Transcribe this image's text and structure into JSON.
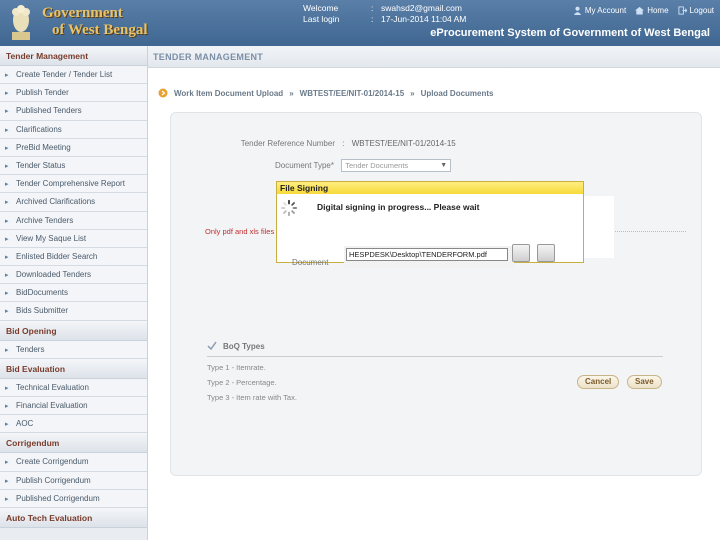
{
  "header": {
    "gov_line1": "Government",
    "gov_line2": "of West Bengal",
    "welcome_label": "Welcome",
    "welcome_value": "swahsd2@gmail.com",
    "lastlogin_label": "Last login",
    "lastlogin_value": "17-Jun-2014 11:04 AM",
    "sep": ":",
    "links": [
      "My Account",
      "Home",
      "Logout"
    ],
    "system_title": "eProcurement System of Government of West Bengal"
  },
  "sidebar": {
    "sections": [
      {
        "title": "Tender Management",
        "items": [
          "Create Tender / Tender List",
          "Publish Tender",
          "Published Tenders",
          "Clarifications",
          "PreBid Meeting",
          "Tender Status",
          "Tender Comprehensive Report",
          "Archived Clarifications",
          "Archive Tenders",
          "View My Saque List",
          "Enlisted Bidder Search",
          "Downloaded Tenders",
          "BidDocuments",
          "Bids Submitter"
        ]
      },
      {
        "title": "Bid Opening",
        "items": [
          "Tenders"
        ]
      },
      {
        "title": "Bid Evaluation",
        "items": [
          "Technical Evaluation",
          "Financial Evaluation",
          "AOC"
        ]
      },
      {
        "title": "Corrigendum",
        "items": [
          "Create Corrigendum",
          "Publish Corrigendum",
          "Published Corrigendum"
        ]
      },
      {
        "title": "Auto Tech Evaluation",
        "items": []
      }
    ]
  },
  "content": {
    "page_title": "TENDER MANAGEMENT",
    "breadcrumb": [
      "Work Item Document Upload",
      "WBTEST/EE/NIT-01/2014-15",
      "Upload Documents"
    ],
    "breadcrumb_sep": "»",
    "form": {
      "ref_label": "Tender Reference Number",
      "ref_value": "WBTEST/EE/NIT-01/2014-15",
      "doctype_label": "Document Type*",
      "doctype_value": "Tender Documents",
      "note": "Only pdf and xls files",
      "document_label": "Document"
    },
    "buttons": {
      "cancel": "Cancel",
      "save": "Save"
    },
    "boq": {
      "title": "BoQ Types",
      "items": [
        "Type 1 - Itemrate.",
        "Type 2 - Percentage.",
        "Type 3 - Item rate with Tax."
      ]
    }
  },
  "dialog": {
    "title": "File Signing",
    "message": "Digital signing in progress... Please wait",
    "file_path": "HESPDESK\\Desktop\\TENDERFORM.pdf"
  },
  "colors": {
    "header": "#4a71a0",
    "accent_gold": "#e8c36a",
    "dialog_title": "#f6d93a",
    "section_text": "#7a3b2b"
  }
}
